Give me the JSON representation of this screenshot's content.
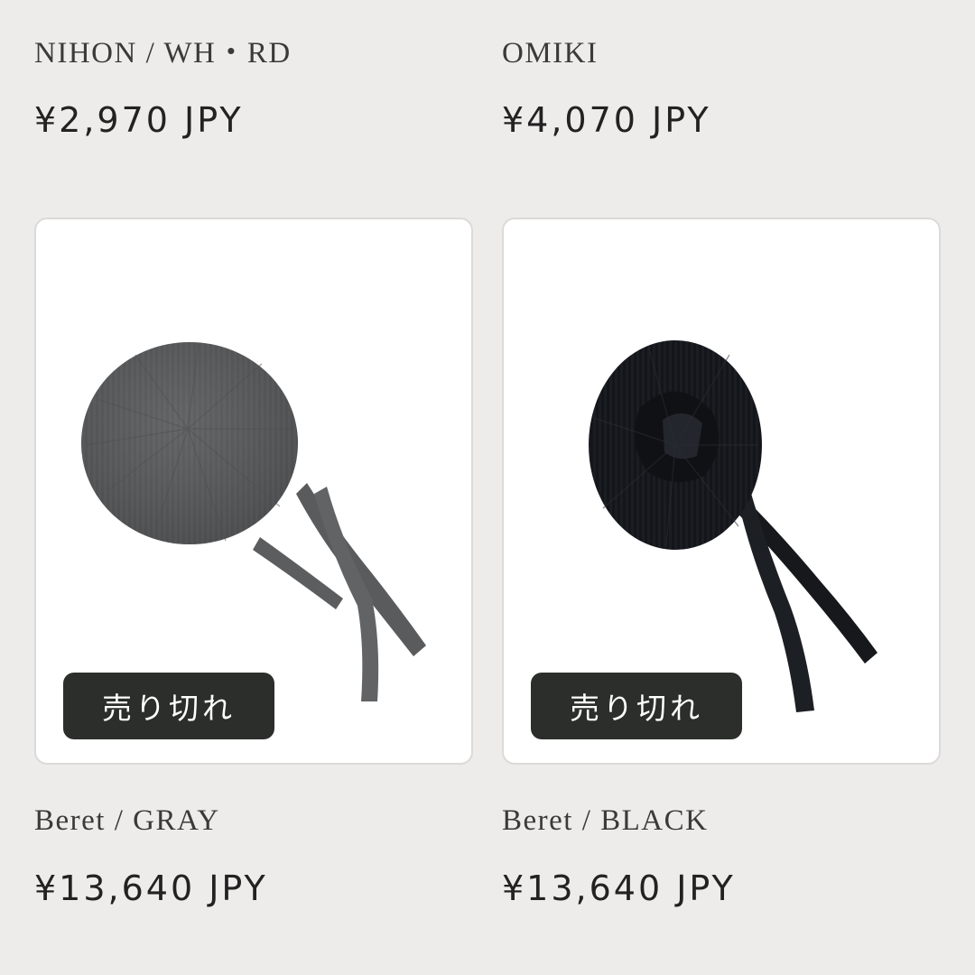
{
  "products_top": [
    {
      "name": "NIHON / WH・RD",
      "price": "¥2,970 JPY"
    },
    {
      "name": "OMIKI",
      "price": "¥4,070 JPY"
    }
  ],
  "products_bottom": [
    {
      "name": "Beret / GRAY",
      "price": "¥13,640 JPY",
      "badge": "売り切れ",
      "image_icon": "gray-beret-image",
      "color": "#5f6061"
    },
    {
      "name": "Beret / BLACK",
      "price": "¥13,640 JPY",
      "badge": "売り切れ",
      "image_icon": "black-beret-image",
      "color": "#16181c"
    }
  ]
}
